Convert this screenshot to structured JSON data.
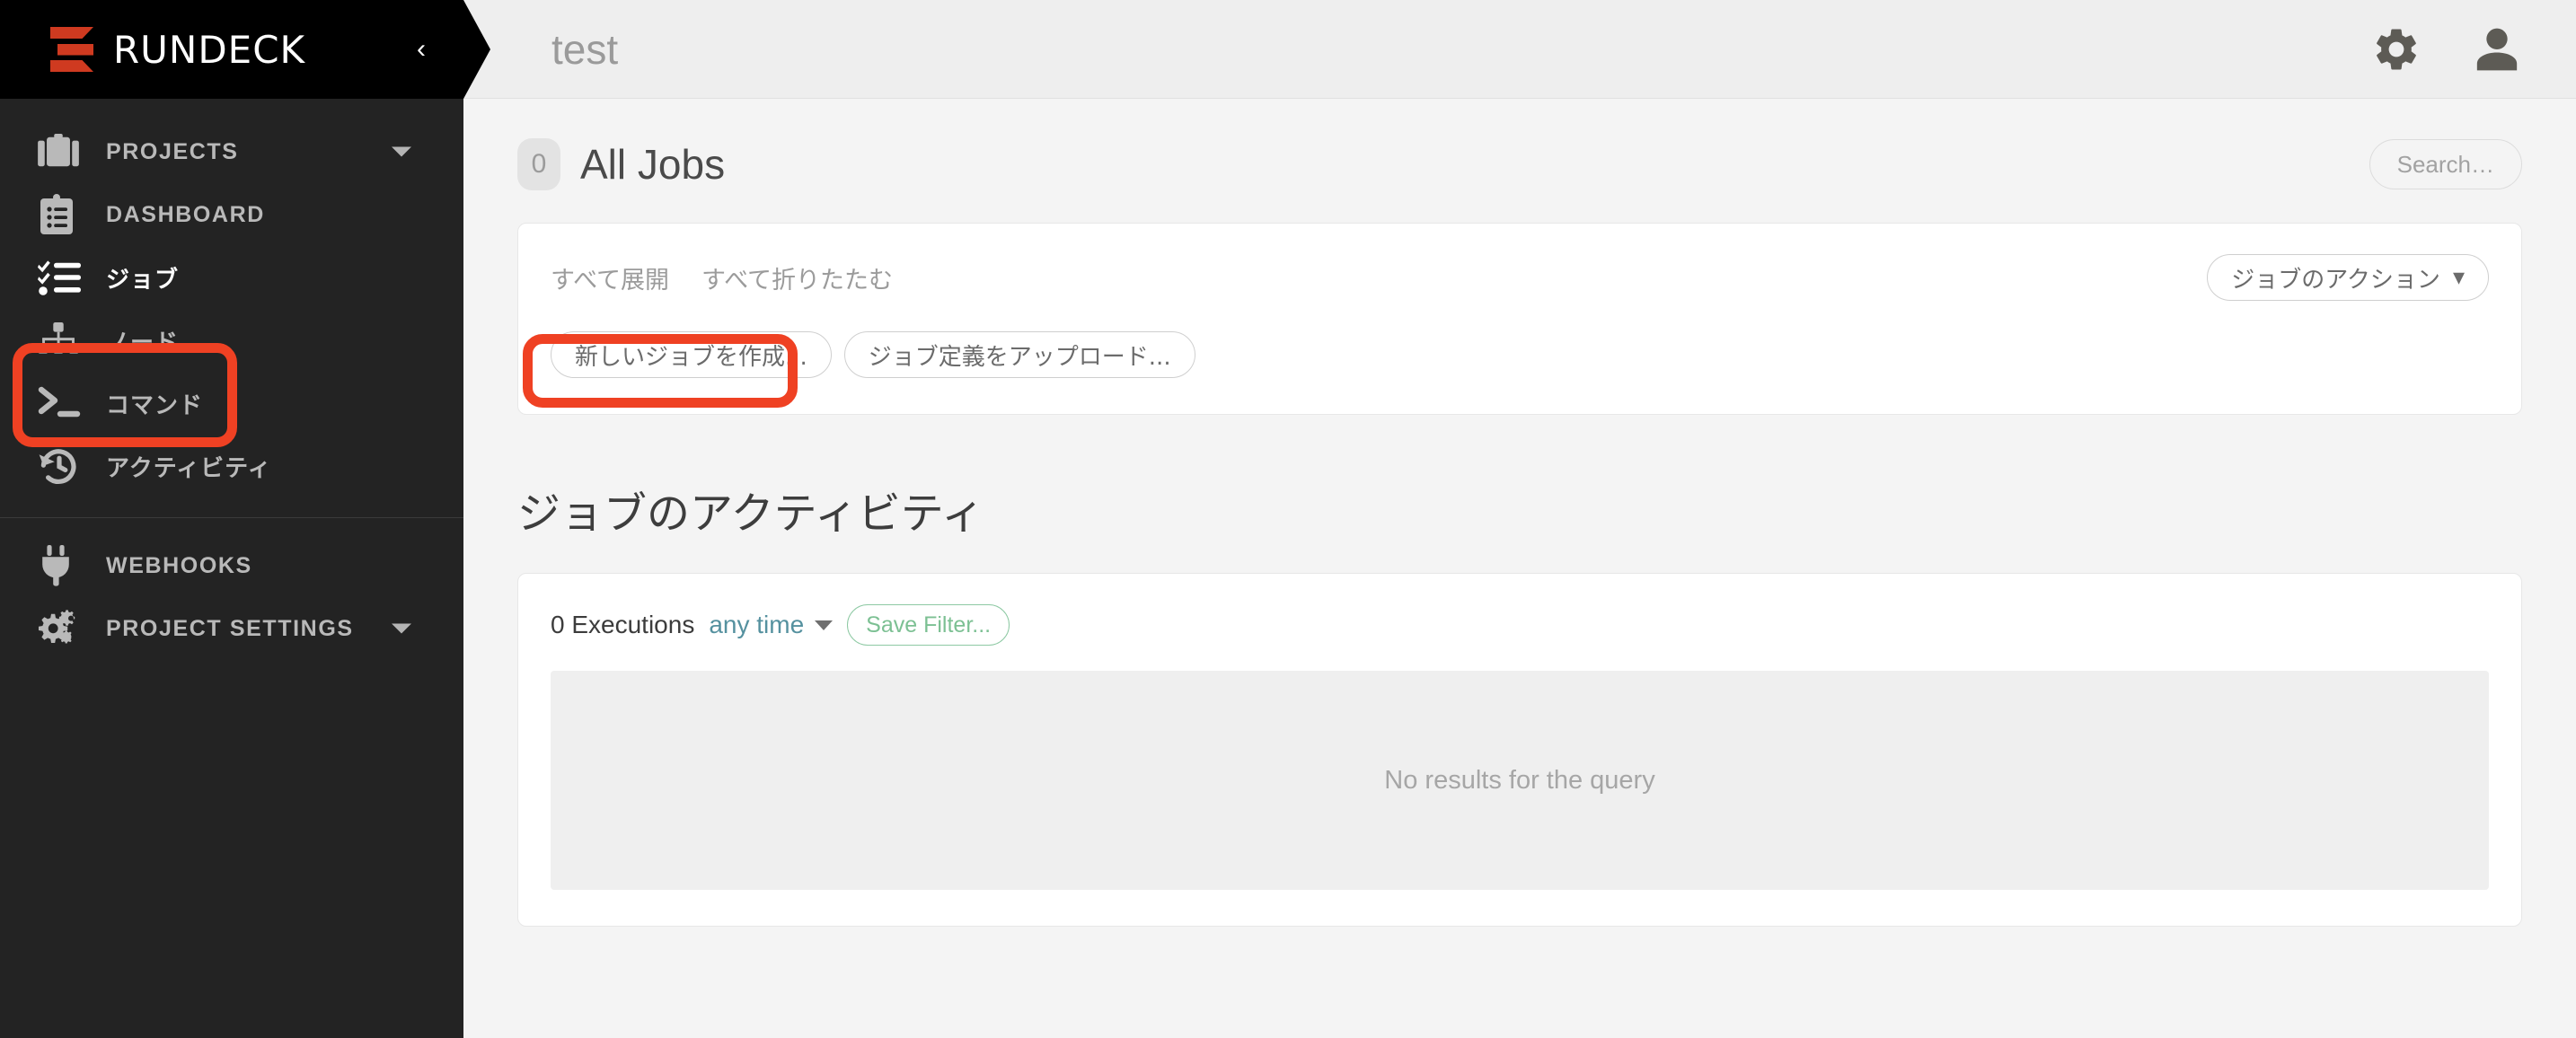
{
  "brand": {
    "name": "RUNDECK",
    "collapse_icon": "chevron-left-icon"
  },
  "sidebar": {
    "items": [
      {
        "label": "PROJECTS",
        "icon": "briefcase-icon",
        "caret": true,
        "active": false
      },
      {
        "label": "DASHBOARD",
        "icon": "clipboard-list-icon",
        "caret": false,
        "active": false
      },
      {
        "label": "ジョブ",
        "icon": "tasks-icon",
        "caret": false,
        "active": true
      },
      {
        "label": "ノード",
        "icon": "sitemap-icon",
        "caret": false,
        "active": false
      },
      {
        "label": "コマンド",
        "icon": "terminal-icon",
        "caret": false,
        "active": false
      },
      {
        "label": "アクティビティ",
        "icon": "history-icon",
        "caret": false,
        "active": false
      }
    ],
    "bottom_items": [
      {
        "label": "WEBHOOKS",
        "icon": "plug-icon",
        "caret": false
      },
      {
        "label": "PROJECT SETTINGS",
        "icon": "cogs-icon",
        "caret": true
      }
    ]
  },
  "topbar": {
    "project_title": "test",
    "gear_icon": "gear-icon",
    "user_icon": "user-icon"
  },
  "page": {
    "count": "0",
    "title": "All Jobs",
    "search_label": "Search…"
  },
  "jobs_card": {
    "expand_all": "すべて展開",
    "collapse_all": "すべて折りたたむ",
    "jobs_action": "ジョブのアクション",
    "jobs_action_caret": "▾",
    "create_job": "新しいジョブを作成...",
    "upload_definition": "ジョブ定義をアップロード..."
  },
  "activity": {
    "section_title": "ジョブのアクティビティ",
    "executions_count": "0 Executions",
    "time_filter": "any time",
    "save_filter": "Save Filter...",
    "empty_message": "No results for the query"
  },
  "colors": {
    "brand_red": "#cf3a20",
    "annotation_red": "#ef4123",
    "sidebar_bg": "#232323",
    "brand_bg": "#000000",
    "link_blue": "#55919f",
    "filter_green": "#7cc093"
  }
}
